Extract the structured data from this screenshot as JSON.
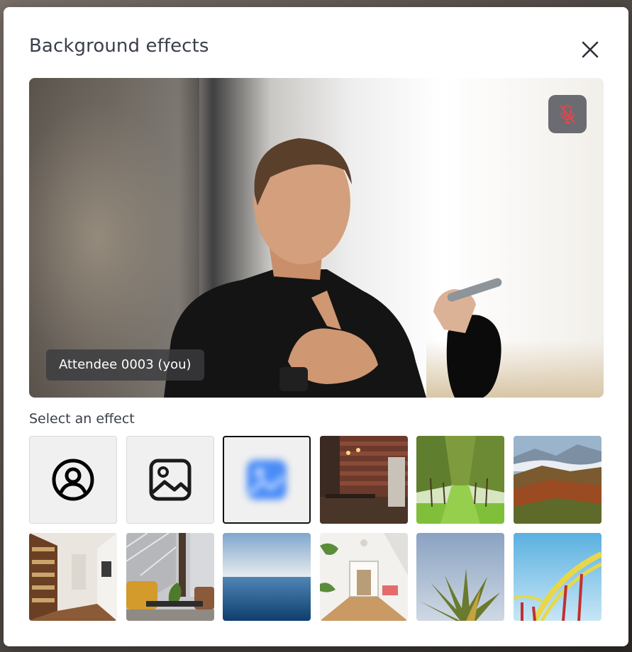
{
  "dialog": {
    "title": "Background effects",
    "close_icon": "close-icon"
  },
  "preview": {
    "participant_label": "Attendee 0003 (you)",
    "mic_icon": "microphone-muted-icon",
    "mic_color": "#e0474c"
  },
  "effects": {
    "section_label": "Select an effect",
    "selected": "blur",
    "tiles": [
      {
        "id": "none",
        "icon": "person-circle-icon"
      },
      {
        "id": "custom-image",
        "icon": "image-icon"
      },
      {
        "id": "blur",
        "icon": "blurred-image-icon"
      },
      {
        "id": "brick-cafe"
      },
      {
        "id": "tree-avenue"
      },
      {
        "id": "mountain-valley"
      },
      {
        "id": "library"
      },
      {
        "id": "lounge"
      },
      {
        "id": "ocean"
      },
      {
        "id": "hallway"
      },
      {
        "id": "palm-leaves"
      },
      {
        "id": "roller-coaster"
      }
    ]
  },
  "colors": {
    "accent_blur_icon": "#4a8cf7",
    "selected_border": "#111111"
  }
}
